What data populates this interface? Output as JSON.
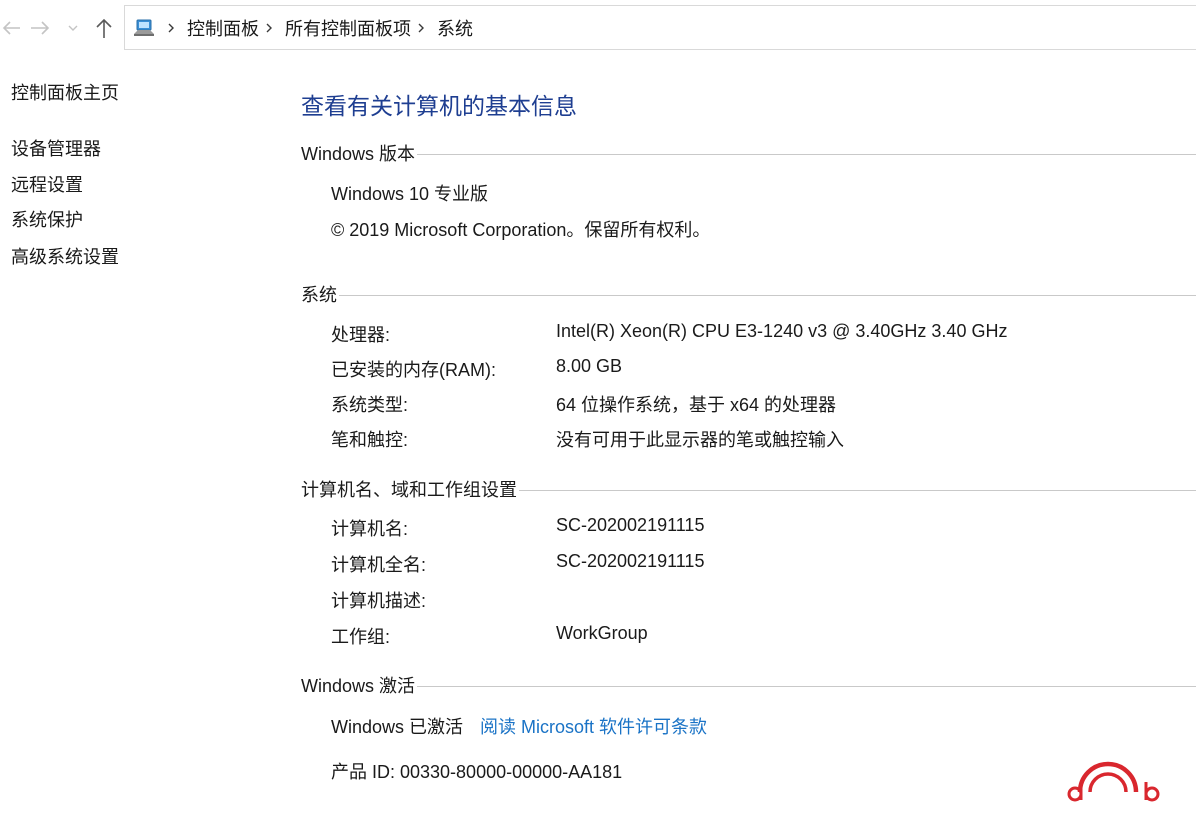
{
  "nav": {
    "back_icon": "arrow-left-icon",
    "forward_icon": "arrow-right-icon",
    "recent_icon": "chevron-down-icon",
    "up_icon": "arrow-up-icon"
  },
  "address": {
    "icon": "control-panel-icon",
    "crumbs": [
      "控制面板",
      "所有控制面板项",
      "系统"
    ]
  },
  "sidebar": {
    "home": "控制面板主页",
    "items": [
      "设备管理器",
      "远程设置",
      "系统保护",
      "高级系统设置"
    ]
  },
  "main": {
    "title": "查看有关计算机的基本信息",
    "edition": {
      "header": "Windows 版本",
      "name": "Windows 10 专业版",
      "copyright": "© 2019 Microsoft Corporation。保留所有权利。"
    },
    "system": {
      "header": "系统",
      "rows": [
        {
          "label": "处理器:",
          "value": "Intel(R) Xeon(R) CPU E3-1240 v3 @ 3.40GHz   3.40 GHz"
        },
        {
          "label": "已安装的内存(RAM):",
          "value": "8.00 GB"
        },
        {
          "label": "系统类型:",
          "value": "64 位操作系统，基于 x64 的处理器"
        },
        {
          "label": "笔和触控:",
          "value": "没有可用于此显示器的笔或触控输入"
        }
      ]
    },
    "computer": {
      "header": "计算机名、域和工作组设置",
      "rows": [
        {
          "label": "计算机名:",
          "value": "SC-202002191115"
        },
        {
          "label": "计算机全名:",
          "value": "SC-202002191115"
        },
        {
          "label": "计算机描述:",
          "value": ""
        },
        {
          "label": "工作组:",
          "value": "WorkGroup"
        }
      ]
    },
    "activation": {
      "header": "Windows 激活",
      "status": "Windows 已激活",
      "license_link": "阅读 Microsoft 软件许可条款",
      "product_id": "产品 ID: 00330-80000-00000-AA181"
    }
  },
  "watermark": {
    "icon": "db-logo-icon",
    "text": "db",
    "color": "#d9272e"
  },
  "colors": {
    "title": "#1e3e91",
    "link": "#1a73c6",
    "rule": "#c9c9c9"
  }
}
